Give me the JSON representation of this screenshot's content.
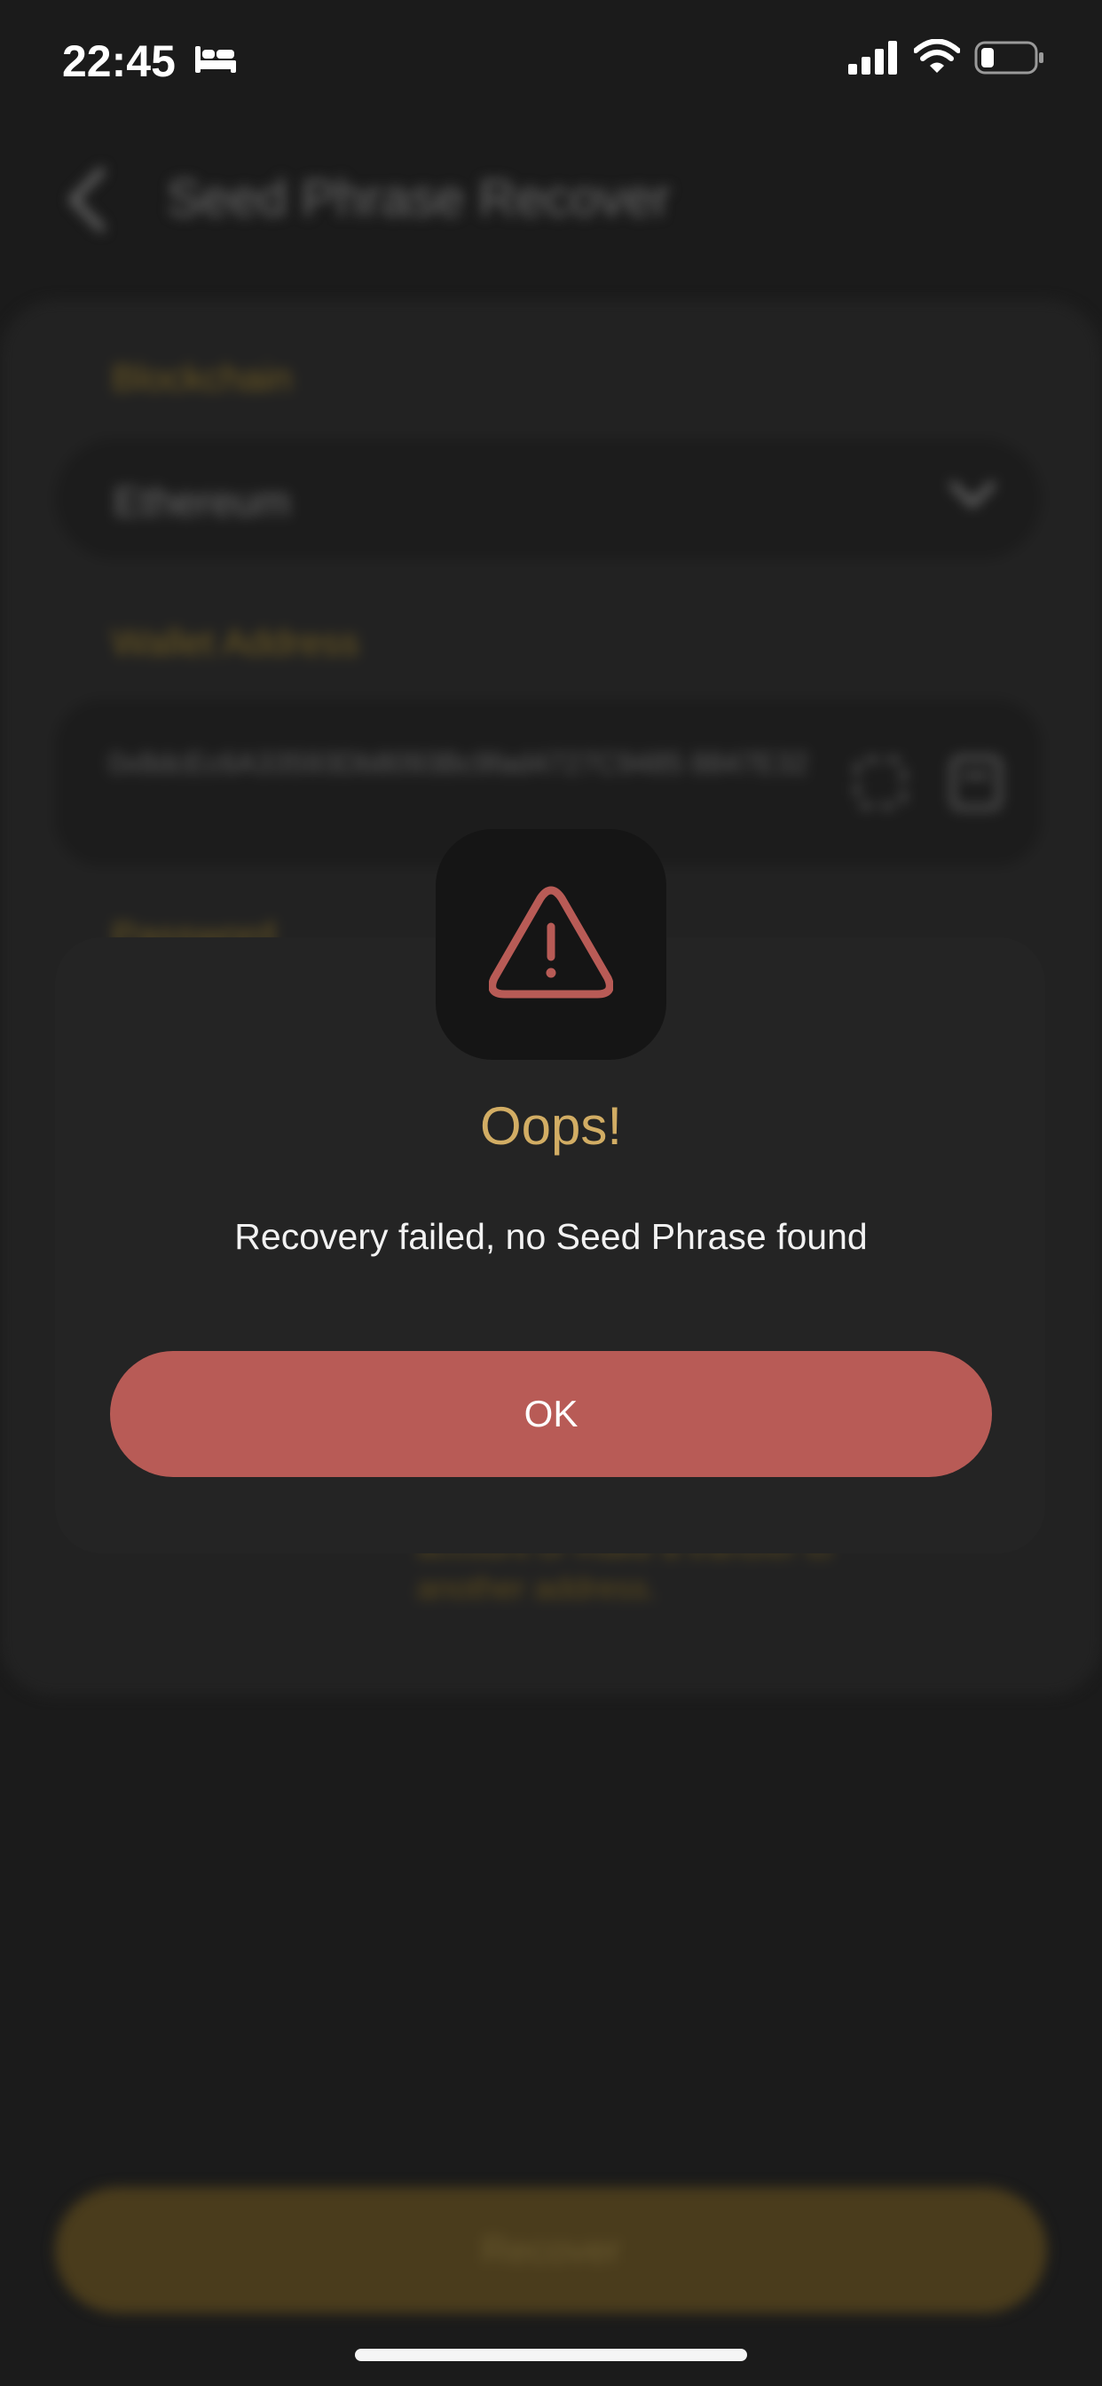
{
  "status_bar": {
    "time": "22:45",
    "icons": [
      "bed-icon",
      "signal-icon",
      "wifi-icon",
      "battery-icon"
    ]
  },
  "header": {
    "title": "Seed Phrase Recover",
    "back_icon": "chevron-left-icon"
  },
  "form": {
    "blockchain_label": "Blockchain",
    "blockchain_value": "Ethereum",
    "wallet_label": "Wallet Address",
    "wallet_address": "0x8dcEc6A33593Db8093Bc9fad4727C9485 8847E32",
    "section_label": "Password",
    "note_text": "account or make a transfer to another address."
  },
  "footer": {
    "recover_label": "Recover"
  },
  "dialog": {
    "title": "Oops!",
    "message": "Recovery failed, no Seed Phrase found",
    "ok_label": "OK",
    "icon": "warning-icon"
  },
  "colors": {
    "accent_gold": "#d2ad64",
    "danger_red": "#b85b56",
    "background": "#1b1b1b"
  }
}
